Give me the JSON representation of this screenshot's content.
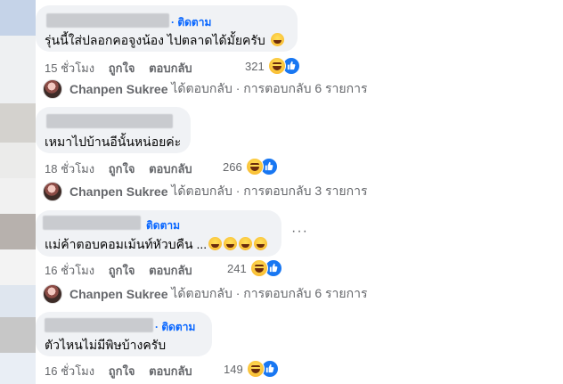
{
  "comments": [
    {
      "follow": "· ติดตาม",
      "text": "รุ่นนี้ใส่ปลอกคอจูงน้อง ไปตลาดได้มั้ยครับ",
      "time": "15 ชั่วโมง",
      "like": "ถูกใจ",
      "reply": "ตอบกลับ",
      "count": "321"
    },
    {
      "follow": "",
      "text": "เหมาไปบ้านอีนั้นหน่อยค่ะ",
      "time": "18 ชั่วโมง",
      "like": "ถูกใจ",
      "reply": "ตอบกลับ",
      "count": "266"
    },
    {
      "follow": "ติดตาม",
      "text": "แม่ค้าตอบคอมเม้นท์หัวบคืน ...",
      "time": "16 ชั่วโมง",
      "like": "ถูกใจ",
      "reply": "ตอบกลับ",
      "count": "241",
      "more": "···"
    },
    {
      "follow": "· ติดตาม",
      "text": "ตัวไหนไม่มีพิษบ้างครับ",
      "time": "16 ชั่วโมง",
      "like": "ถูกใจ",
      "reply": "ตอบกลับ",
      "count": "149"
    }
  ],
  "replies": [
    {
      "name": "Chanpen Sukree",
      "text": "ได้ตอบกลับ · การตอบกลับ 6 รายการ"
    },
    {
      "name": "Chanpen Sukree",
      "text": "ได้ตอบกลับ · การตอบกลับ 3 รายการ"
    },
    {
      "name": "Chanpen Sukree",
      "text": "ได้ตอบกลับ · การตอบกลับ 6 รายการ"
    }
  ],
  "icons": {
    "reaction_haha": "haha-emoji-icon",
    "reaction_like": "like-thumb-icon",
    "avatar": "profile-avatar"
  },
  "colors": {
    "bubble": "#f0f2f5",
    "follow": "#0866ff",
    "meta": "#65676b",
    "like": "#1877f2"
  }
}
